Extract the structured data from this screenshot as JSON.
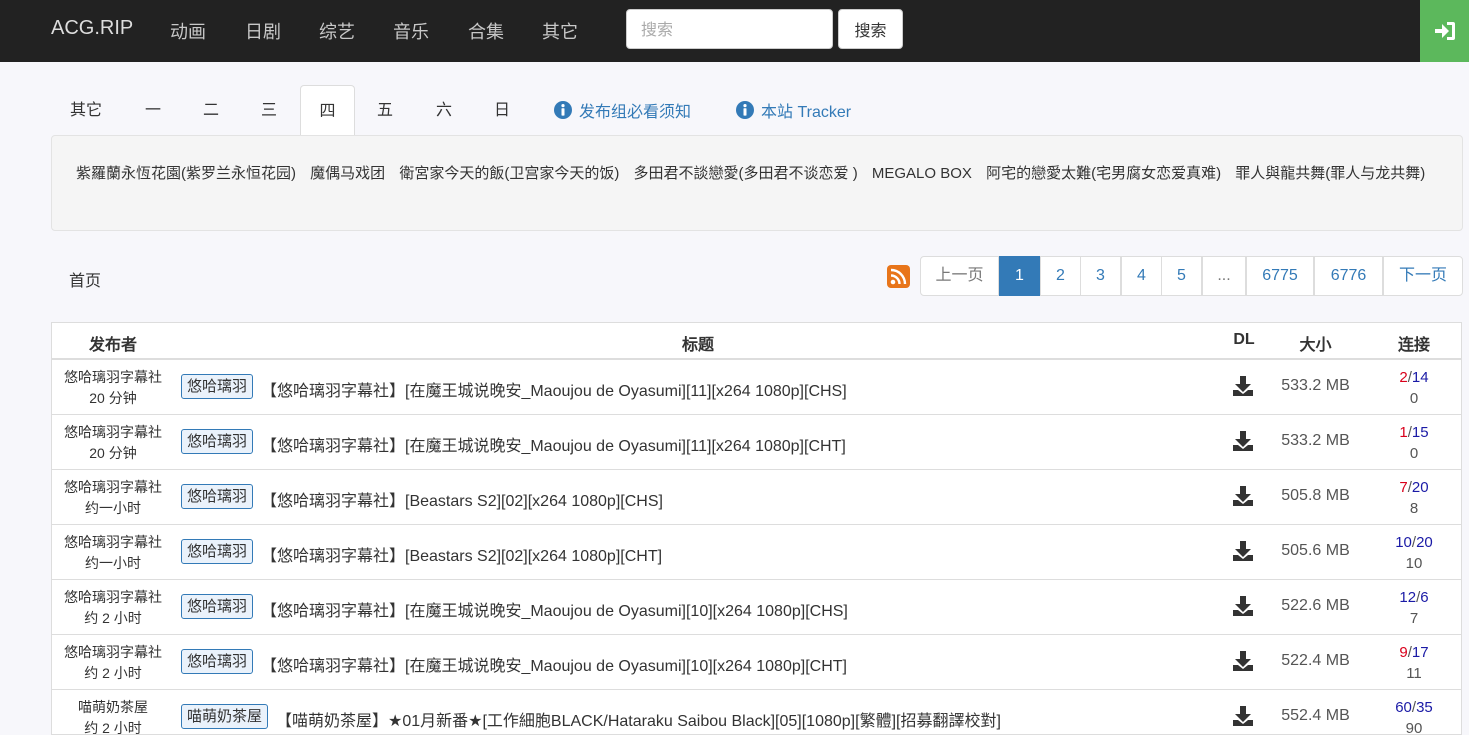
{
  "navbar": {
    "brand": "ACG.RIP",
    "links": [
      "动画",
      "日剧",
      "综艺",
      "音乐",
      "合集",
      "其它"
    ],
    "search_placeholder": "搜索",
    "search_button": "搜索",
    "login_icon": "sign-in-icon"
  },
  "tabs": {
    "days": [
      "其它",
      "一",
      "二",
      "三",
      "四",
      "五",
      "六",
      "日"
    ],
    "active": "四",
    "links": [
      "发布组必看须知",
      "本站 Tracker"
    ]
  },
  "anime_list": [
    "紫羅蘭永恆花園(紫罗兰永恒花园)",
    "魔偶马戏团",
    "衛宮家今天的飯(卫宫家今天的饭)",
    "多田君不談戀愛(多田君不谈恋爱 )",
    "MEGALO BOX",
    "阿宅的戀愛太難(宅男腐女恋爱真难)",
    "罪人與龍共舞(罪人与龙共舞)"
  ],
  "breadcrumb": {
    "home": "首页"
  },
  "pagination": {
    "items": [
      "上一页",
      "1",
      "2",
      "3",
      "4",
      "5",
      "...",
      "6775",
      "6776",
      "下一页"
    ],
    "active": "1"
  },
  "table": {
    "headers": [
      "发布者",
      "标题",
      "DL",
      "大小",
      "连接"
    ],
    "rows": [
      {
        "publisher": "悠哈璃羽字幕社",
        "time": "20 分钟",
        "tag": "悠哈璃羽",
        "title": "【悠哈璃羽字幕社】[在魔王城说晚安_Maoujou de Oyasumi][11][x264 1080p][CHS]",
        "size": "533.2 MB",
        "seeders": "2",
        "leechers": "14",
        "completed": "0"
      },
      {
        "publisher": "悠哈璃羽字幕社",
        "time": "20 分钟",
        "tag": "悠哈璃羽",
        "title": "【悠哈璃羽字幕社】[在魔王城说晚安_Maoujou de Oyasumi][11][x264 1080p][CHT]",
        "size": "533.2 MB",
        "seeders": "1",
        "leechers": "15",
        "completed": "0"
      },
      {
        "publisher": "悠哈璃羽字幕社",
        "time": "约一小时",
        "tag": "悠哈璃羽",
        "title": "【悠哈璃羽字幕社】[Beastars S2][02][x264 1080p][CHS]",
        "size": "505.8 MB",
        "seeders": "7",
        "leechers": "20",
        "completed": "8"
      },
      {
        "publisher": "悠哈璃羽字幕社",
        "time": "约一小时",
        "tag": "悠哈璃羽",
        "title": "【悠哈璃羽字幕社】[Beastars S2][02][x264 1080p][CHT]",
        "size": "505.6 MB",
        "seeders": "10",
        "leechers": "20",
        "completed": "10"
      },
      {
        "publisher": "悠哈璃羽字幕社",
        "time": "约 2 小时",
        "tag": "悠哈璃羽",
        "title": "【悠哈璃羽字幕社】[在魔王城说晚安_Maoujou de Oyasumi][10][x264 1080p][CHS]",
        "size": "522.6 MB",
        "seeders": "12",
        "leechers": "6",
        "completed": "7"
      },
      {
        "publisher": "悠哈璃羽字幕社",
        "time": "约 2 小时",
        "tag": "悠哈璃羽",
        "title": "【悠哈璃羽字幕社】[在魔王城说晚安_Maoujou de Oyasumi][10][x264 1080p][CHT]",
        "size": "522.4 MB",
        "seeders": "9",
        "leechers": "17",
        "completed": "11"
      },
      {
        "publisher": "喵萌奶茶屋",
        "time": "约 2 小时",
        "tag": "喵萌奶茶屋",
        "title": "【喵萌奶茶屋】★01月新番★[工作細胞BLACK/Hataraku Saibou Black][05][1080p][繁體][招募翻譯校對]",
        "size": "552.4 MB",
        "seeders": "60",
        "leechers": "35",
        "completed": "90"
      }
    ]
  },
  "colors": {
    "navbar": "#222222",
    "accent": "#337ab7",
    "login": "#5cb85c",
    "seeders_low": "#d9001b",
    "seeders_high": "#1a1aa6"
  }
}
